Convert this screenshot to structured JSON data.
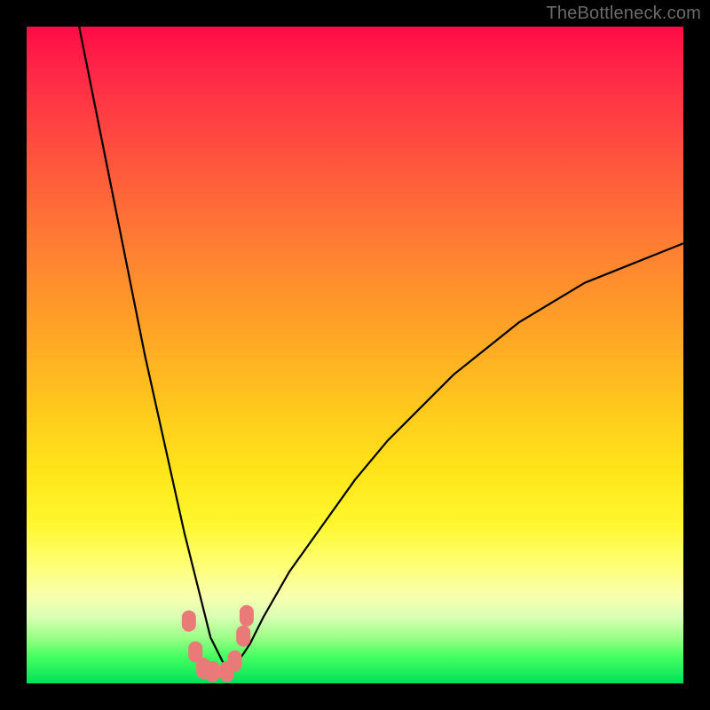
{
  "watermark": {
    "text": "TheBottleneck.com"
  },
  "chart_data": {
    "type": "line",
    "title": "",
    "xlabel": "",
    "ylabel": "",
    "xlim": [
      0,
      100
    ],
    "ylim": [
      0,
      100
    ],
    "grid": false,
    "legend": false,
    "description": "V-shaped bottleneck curve over a vertical rainbow gradient (red high, green low). Curve value is approximately 0 near x≈27–32 and rises steeply on both sides; left side reaches ~100 near x≈8, right side rises to ~67 at x=100.",
    "series": [
      {
        "name": "bottleneck-curve",
        "color": "#000000",
        "x": [
          8,
          10,
          12,
          14,
          16,
          18,
          20,
          22,
          24,
          26,
          28,
          30,
          32,
          34,
          36,
          40,
          45,
          50,
          55,
          60,
          65,
          70,
          75,
          80,
          85,
          90,
          95,
          100
        ],
        "values": [
          100,
          90,
          80,
          70,
          60,
          50,
          41,
          32,
          23,
          15,
          7,
          3,
          3,
          6,
          10,
          17,
          24,
          31,
          37,
          42,
          47,
          51,
          55,
          58,
          61,
          63,
          65,
          67
        ]
      },
      {
        "name": "trough-markers",
        "color": "#ea7a78",
        "type": "scatter",
        "x": [
          24.7,
          25.7,
          26.9,
          28.3,
          30.5,
          31.7,
          33.0,
          33.5
        ],
        "values": [
          9.5,
          4.8,
          2.3,
          1.8,
          1.8,
          3.4,
          7.2,
          10.3
        ]
      }
    ],
    "background_gradient": {
      "direction": "vertical",
      "stops": [
        {
          "pos": 0.0,
          "color": "#ff0b46"
        },
        {
          "pos": 0.32,
          "color": "#ff7a34"
        },
        {
          "pos": 0.68,
          "color": "#ffe61a"
        },
        {
          "pos": 0.88,
          "color": "#f0ffb2"
        },
        {
          "pos": 1.0,
          "color": "#00e25a"
        }
      ]
    }
  }
}
